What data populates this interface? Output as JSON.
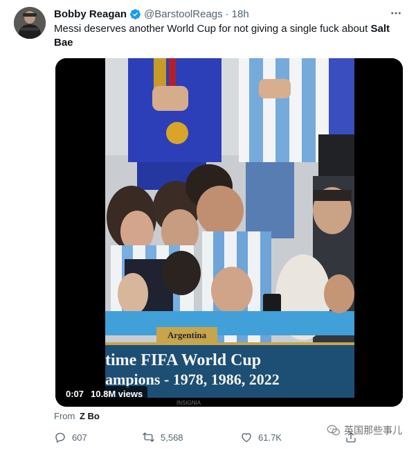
{
  "tweet": {
    "display_name": "Bobby Reagan",
    "handle": "@BarstoolReags",
    "separator": "·",
    "time": "18h",
    "text_parts": [
      "Messi deserves another World Cup for not giving a single fuck about ",
      "Salt Bae"
    ],
    "verified_color": "#1d9bf0"
  },
  "media": {
    "duration": "0:07",
    "views": "10.8M views",
    "caption_tag": "Argentina",
    "caption_line1": "time FIFA World Cup",
    "caption_line2": "ampions - 1978, 1986, 2022",
    "bottom_text": "INSIGNIA"
  },
  "source": {
    "prefix": "From",
    "name": "Z Bo"
  },
  "actions": {
    "reply_count": "607",
    "retweet_count": "5,568",
    "like_count": "61.7K"
  },
  "watermark": {
    "text": "英国那些事儿"
  },
  "icons": {
    "more": "more-icon",
    "reply": "reply-icon",
    "retweet": "retweet-icon",
    "like": "heart-icon",
    "share": "share-icon"
  }
}
